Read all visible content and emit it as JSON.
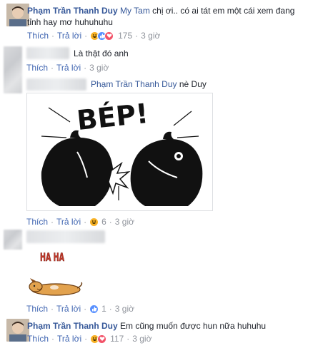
{
  "comments": [
    {
      "author": "Phạm Trần Thanh Duy",
      "tag": "My Tam",
      "text_line1": "chị ơi.. có ai tát em một cái xem đang",
      "text_line2": "tỉnh hay mơ huhuhuhu",
      "like_label": "Thích",
      "reply_label": "Trả lời",
      "reaction_count": "175",
      "time": "3 giờ"
    },
    {
      "text": "Là thật đó anh",
      "like_label": "Thích",
      "reply_label": "Trả lời",
      "time": "3 giờ"
    },
    {
      "tag": "Phạm Trần Thanh Duy",
      "text": "nè Duy",
      "sticker_text": "BÉP!",
      "like_label": "Thích",
      "reply_label": "Trả lời",
      "reaction_count": "6",
      "time": "3 giờ"
    },
    {
      "sticker_text": "HA HA",
      "like_label": "Thích",
      "reply_label": "Trả lời",
      "reaction_count": "1",
      "time": "3 giờ"
    },
    {
      "author": "Phạm Trần Thanh Duy",
      "text": "Em cũng muốn được hun nữa huhuhu",
      "like_label": "Thích",
      "reply_label": "Trả lời",
      "reaction_count": "117",
      "time": "3 giờ"
    }
  ],
  "separator": "·",
  "colors": {
    "link": "#4267b2",
    "name": "#365899",
    "meta": "#90949c",
    "haha": "#f7b125",
    "like": "#5890ff",
    "love": "#f25268"
  }
}
